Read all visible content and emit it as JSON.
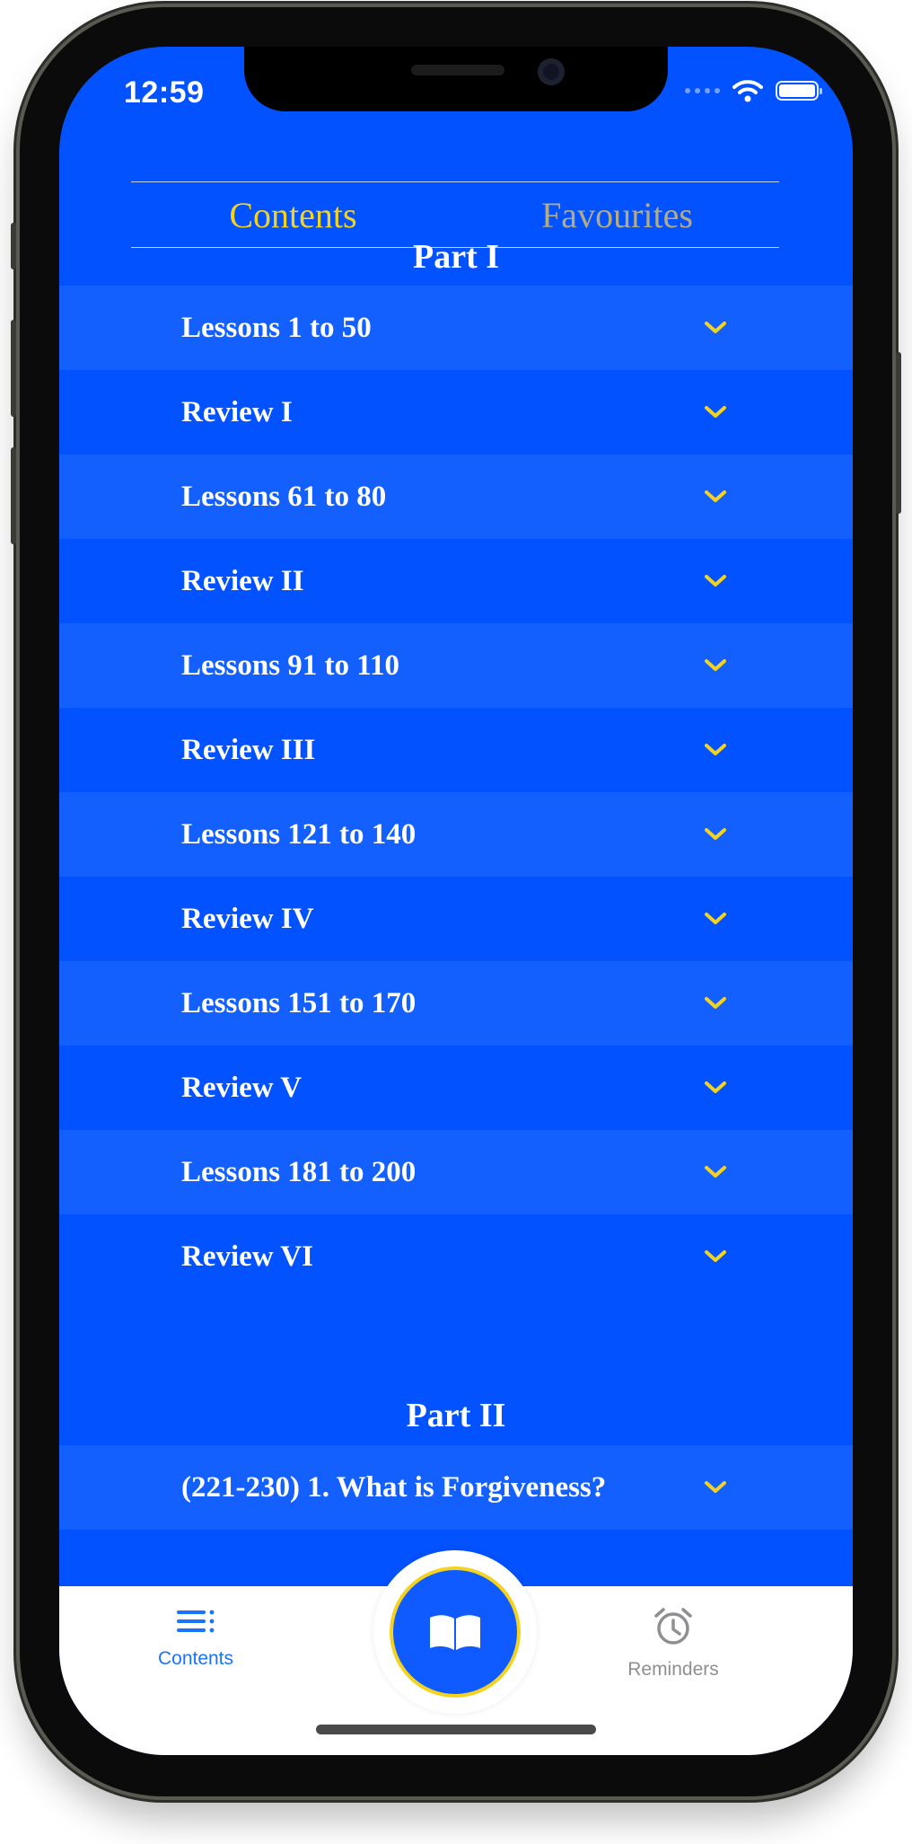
{
  "status_bar": {
    "time": "12:59"
  },
  "segments": {
    "contents": "Contents",
    "favourites": "Favourites"
  },
  "sections": [
    {
      "title": "Part I",
      "items": [
        "Lessons 1 to 50",
        "Review I",
        "Lessons 61 to 80",
        "Review II",
        "Lessons 91 to 110",
        "Review III",
        "Lessons 121 to 140",
        "Review IV",
        "Lessons 151 to 170",
        "Review V",
        "Lessons 181 to 200",
        "Review VI"
      ]
    },
    {
      "title": "Part II",
      "items": [
        "(221-230)  1. What is Forgiveness?"
      ]
    }
  ],
  "tab_bar": {
    "contents_label": "Contents",
    "reminders_label": "Reminders"
  },
  "colors": {
    "background": "#0352ff",
    "row_alt": "#1360ff",
    "accent": "#f4d320",
    "tab_active": "#1a73ff"
  },
  "icons": {
    "row_chevron": "chevron-down-icon",
    "tab_contents": "list-icon",
    "fab": "book-icon",
    "tab_reminders": "alarm-clock-icon"
  }
}
